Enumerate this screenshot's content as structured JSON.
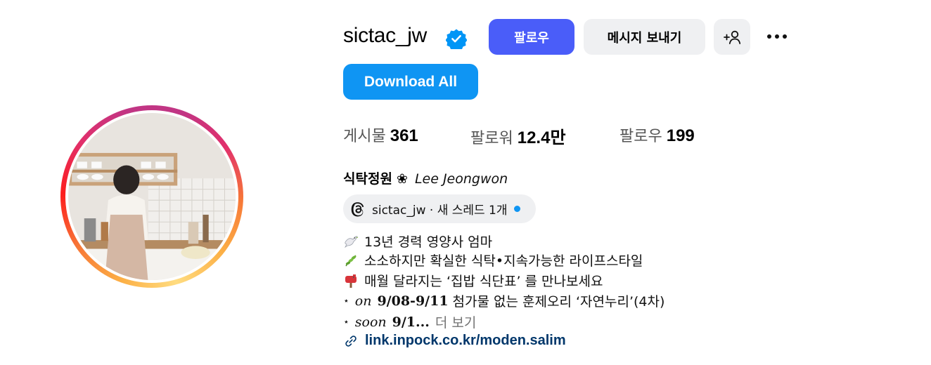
{
  "profile": {
    "username": "sictac_jw",
    "verified": true,
    "verified_color": "#0095f6"
  },
  "actions": {
    "follow_label": "팔로우",
    "message_label": "메시지 보내기",
    "download_label": "Download All",
    "follow_color": "#4a5df9",
    "download_color": "#0f95f3"
  },
  "stats": [
    {
      "label": "게시물",
      "value": "361"
    },
    {
      "label": "팔로워",
      "value": "12.4만"
    },
    {
      "label": "팔로우",
      "value": "199"
    }
  ],
  "bio": {
    "name_korean": "식탁정원",
    "name_symbol": "❀",
    "name_english": "Lee Jeongwon",
    "threads": {
      "text": "sictac_jw · 새 스레드 1개"
    },
    "lines": [
      {
        "icon": "dove-icon",
        "text": "13년 경력 영양사 엄마"
      },
      {
        "icon": "herb-icon",
        "text": "소소하지만 확실한 식탁•지속가능한 라이프스타일"
      },
      {
        "icon": "mailbox-icon",
        "text": "매월 달라지는 ‘집밥 식단표’ 를 만나보세요"
      }
    ],
    "line4": {
      "bullet": "⋆",
      "word": "on",
      "dates": "9/08-9/11",
      "text": "첨가물 없는 훈제오리 ‘자연누리’(4차)"
    },
    "line5": {
      "bullet": "⋆",
      "word": "soon",
      "dates": "9/1...",
      "more": "더 보기"
    },
    "link": "link.inpock.co.kr/moden.salim"
  }
}
